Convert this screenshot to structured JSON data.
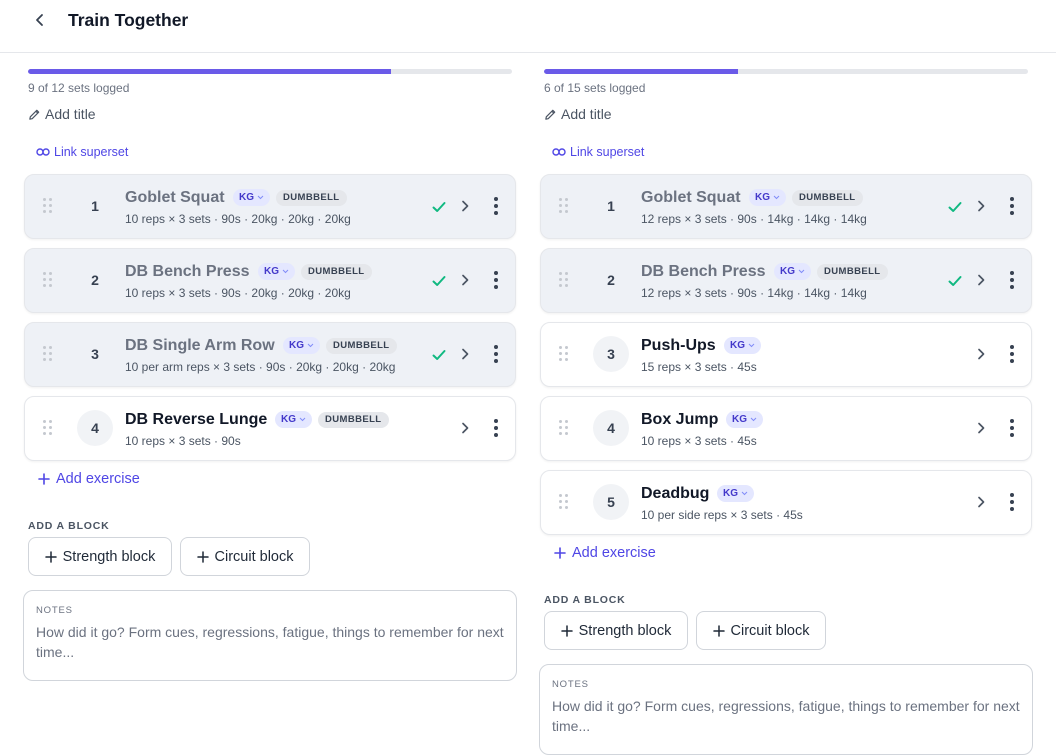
{
  "header": {
    "title": "Train Together"
  },
  "columns": [
    {
      "progress": {
        "text": "9 of 12 sets logged",
        "fraction": 0.75
      },
      "add_title": "Add title",
      "link_superset": "Link superset",
      "exercises": [
        {
          "num": "1",
          "name": "Goblet Squat",
          "kg": "KG",
          "equipment": "DUMBBELL",
          "detail": "10 reps × 3 sets · 90s · 20kg · 20kg · 20kg",
          "done": true
        },
        {
          "num": "2",
          "name": "DB Bench Press",
          "kg": "KG",
          "equipment": "DUMBBELL",
          "detail": "10 reps × 3 sets · 90s · 20kg · 20kg · 20kg",
          "done": true
        },
        {
          "num": "3",
          "name": "DB Single Arm Row",
          "kg": "KG",
          "equipment": "DUMBBELL",
          "detail": "10 per arm reps × 3 sets · 90s · 20kg · 20kg · 20kg",
          "done": true
        },
        {
          "num": "4",
          "name": "DB Reverse Lunge",
          "kg": "KG",
          "equipment": "DUMBBELL",
          "detail": "10 reps × 3 sets · 90s",
          "done": false
        }
      ],
      "add_exercise": "Add exercise",
      "add_block_label": "ADD A BLOCK",
      "strength_block": "Strength block",
      "circuit_block": "Circuit block",
      "notes_label": "NOTES",
      "notes_placeholder": "How did it go? Form cues, regressions, fatigue, things to remember for next time..."
    },
    {
      "progress": {
        "text": "6 of 15 sets logged",
        "fraction": 0.4
      },
      "add_title": "Add title",
      "link_superset": "Link superset",
      "exercises": [
        {
          "num": "1",
          "name": "Goblet Squat",
          "kg": "KG",
          "equipment": "DUMBBELL",
          "detail": "12 reps × 3 sets · 90s · 14kg · 14kg · 14kg",
          "done": true
        },
        {
          "num": "2",
          "name": "DB Bench Press",
          "kg": "KG",
          "equipment": "DUMBBELL",
          "detail": "12 reps × 3 sets · 90s · 14kg · 14kg · 14kg",
          "done": true
        },
        {
          "num": "3",
          "name": "Push-Ups",
          "kg": "KG",
          "equipment": "",
          "detail": "15 reps × 3 sets · 45s",
          "done": false
        },
        {
          "num": "4",
          "name": "Box Jump",
          "kg": "KG",
          "equipment": "",
          "detail": "10 reps × 3 sets · 45s",
          "done": false
        },
        {
          "num": "5",
          "name": "Deadbug",
          "kg": "KG",
          "equipment": "",
          "detail": "10 per side reps × 3 sets · 45s",
          "done": false
        }
      ],
      "add_exercise": "Add exercise",
      "add_block_label": "ADD A BLOCK",
      "strength_block": "Strength block",
      "circuit_block": "Circuit block",
      "notes_label": "NOTES",
      "notes_placeholder": "How did it go? Form cues, regressions, fatigue, things to remember for next time..."
    }
  ],
  "icons": {
    "back": "chevron-left-icon",
    "pencil": "pencil-icon",
    "link": "link-icon",
    "drag": "drag-handle-icon",
    "check": "check-icon",
    "chevron": "chevron-right-icon",
    "more": "more-vertical-icon",
    "plus": "plus-icon"
  },
  "colors": {
    "accent": "#4f46e5",
    "progress": "#6a5ae8",
    "check": "#10b981",
    "done_card": "#eef1f6"
  }
}
